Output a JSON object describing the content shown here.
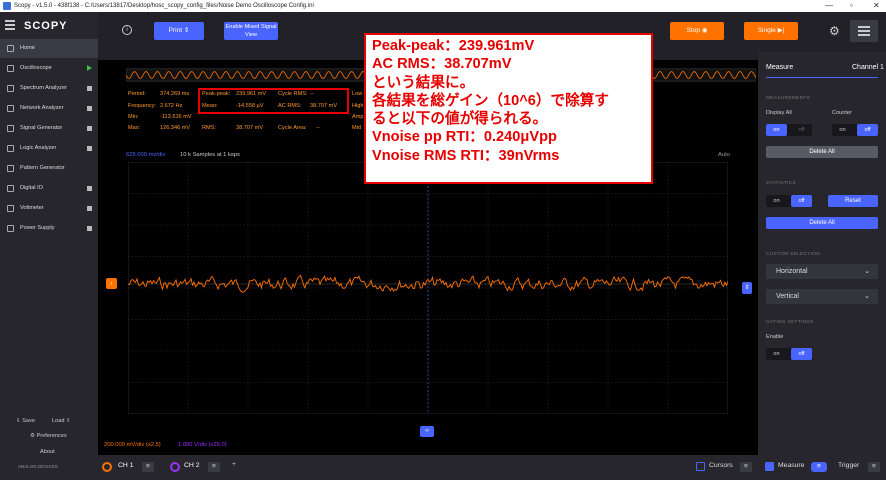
{
  "window": {
    "title": "Scopy - v1.5.0 - 438f138 - C:/Users/13817/Desktop/hosc_scopy_config_files/Noise Demo Oscilloscope Config.ini"
  },
  "sidebar": {
    "logo": "SCOPY",
    "items": [
      {
        "label": "Home"
      },
      {
        "label": "Oscilloscope"
      },
      {
        "label": "Spectrum Analyzer"
      },
      {
        "label": "Network Analyzer"
      },
      {
        "label": "Signal Generator"
      },
      {
        "label": "Logic Analyzer"
      },
      {
        "label": "Pattern Generator"
      },
      {
        "label": "Digital IO"
      },
      {
        "label": "Voltmeter"
      },
      {
        "label": "Power Supply"
      }
    ],
    "save": "Save",
    "load": "Load",
    "preferences": "Preferences",
    "about": "About",
    "vendor": "ANALOG DEVICES"
  },
  "toolbar": {
    "info": "i",
    "print": "Print",
    "mixed_signal": "Enable Mixed Signal View",
    "stop": "Stop",
    "single": "Single"
  },
  "measurements": {
    "period_label": "Period:",
    "period_value": "374.269 ms",
    "frequency_label": "Frequency:",
    "frequency_value": "2.672 Hz",
    "min_label": "Min:",
    "min_value": "-113.616 mV",
    "max_label": "Max:",
    "max_value": "126.346 mV",
    "peakpeak_label": "Peak-peak:",
    "peakpeak_value": "239.961 mV",
    "mean_label": "Mean:",
    "mean_value": "-14.558 µV",
    "rms_label": "RMS:",
    "rms_value": "38.707 mV",
    "acrms_label": "AC RMS:",
    "acrms_value": "38.707 mV",
    "cycle_rms_label": "Cycle RMS:",
    "cycle_rms_value": "--",
    "cycle_area_label": "Cycle Area:",
    "cycle_area_value": "--",
    "low_label": "Low",
    "high_label": "High",
    "amp_label": "Amp",
    "mid_label": "Mid"
  },
  "plot": {
    "timebase": "625.000 ms/div",
    "samples": "10 k Samples at 1 ksps",
    "auto": "Auto",
    "ch1_scale": "200.000 mV/div (x2.5)",
    "ch2_scale": "1.000 V/div (x25.0)",
    "trigger_marker": "T",
    "ch1_marker": "1"
  },
  "measure_panel": {
    "title": "Measure",
    "channel": "Channel 1",
    "sec_measurements": "MEASUREMENTS",
    "display_all": "Display All",
    "counter": "Counter",
    "on": "on",
    "off": "off",
    "delete_all": "Delete All",
    "sec_statistics": "STATISTICS",
    "reset": "Reset",
    "sec_custom": "CUSTOM SELECTION",
    "horizontal": "Horizontal",
    "vertical": "Vertical",
    "sec_gating": "GATING SETTINGS",
    "enable": "Enable"
  },
  "bottom": {
    "ch1": "CH 1",
    "ch2": "CH 2",
    "add": "+",
    "cursors": "Cursors",
    "measure": "Measure",
    "trigger": "Trigger"
  },
  "annotation": {
    "lines": [
      "Peak-peak：239.961mV",
      "AC RMS：38.707mV",
      "という結果に。",
      "各結果を総ゲイン（10^6）で除算す",
      "ると以下の値が得られる。",
      "Vnoise pp RTI：0.240μVpp",
      "Vnoise RMS RTI：39nVrms"
    ]
  },
  "colors": {
    "ch1": "#ff7200",
    "ch2": "#9b30ff",
    "accent": "#4a64ff",
    "stop": "#ff7200",
    "annotation": "#e60000"
  }
}
